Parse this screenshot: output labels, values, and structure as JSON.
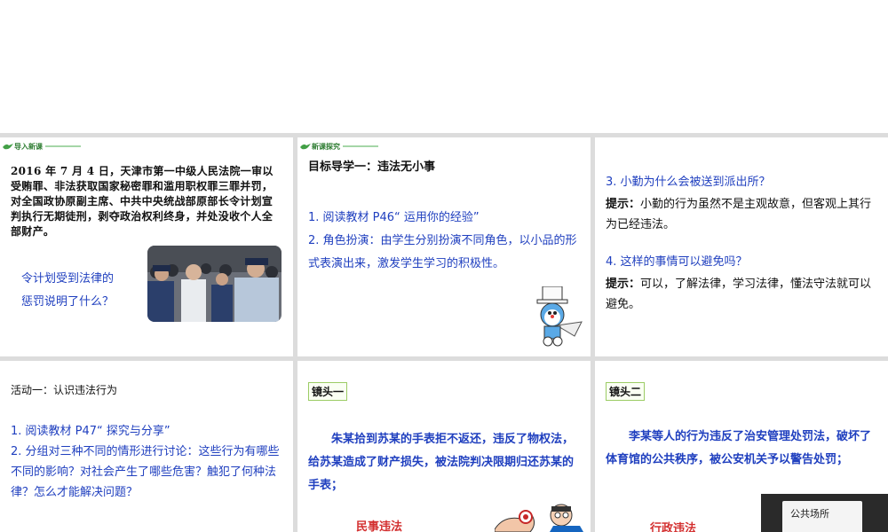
{
  "s1": {
    "banner": "导入新课",
    "news": "2016 年 7 月 4 日，天津市第一中级人民法院一审以受贿罪、非法获取国家秘密罪和滥用职权罪三罪并罚，对全国政协原副主席、中共中央统战部原部长令计划宣判执行无期徒刑，剥夺政治权利终身，并处没收个人全部财产。",
    "question_line1": "令计划受到法律的",
    "question_line2": "惩罚说明了什么？"
  },
  "s2": {
    "banner": "新课探究",
    "title": "目标导学一：违法无小事",
    "items": [
      "1. 阅读教材 P46“ 运用你的经验”",
      "2. 角色扮演：由学生分别扮演不同角色，以小品的形式表演出来，激发学生学习的积极性。"
    ]
  },
  "s3": {
    "q3": "3. 小勤为什么会被送到派出所？",
    "hint_label": "提示：",
    "a3": "小勤的行为虽然不是主观故意，但客观上其行为已经违法。",
    "q4": "4. 这样的事情可以避免吗？",
    "a4": "可以，了解法律，学习法律，懂法守法就可以避免。"
  },
  "s4": {
    "title": "活动一：认识违法行为",
    "items": [
      "1. 阅读教材 P47“ 探究与分享”",
      "2. 分组对三种不同的情形进行讨论：这些行为有哪些不同的影响？对社会产生了哪些危害？触犯了何种法律？怎么才能解决问题？"
    ]
  },
  "s5": {
    "camera": "镜头一",
    "case": "朱某拾到苏某的手表拒不返还，违反了物权法，给苏某造成了财产损失，被法院判决限期归还苏某的手表；",
    "law": "民事违法"
  },
  "s6": {
    "camera": "镜头二",
    "case": "李某等人的行为违反了治安管理处罚法，破坏了体育馆的公共秩序，被公安机关予以警告处罚；",
    "law": "行政违法",
    "sign": "公共场所"
  }
}
